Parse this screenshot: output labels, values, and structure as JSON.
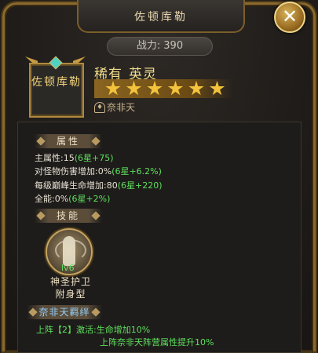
{
  "window": {
    "title": "佐顿库勒"
  },
  "power": {
    "label": "战力:",
    "value": "390"
  },
  "hero": {
    "portrait_name": "佐顿库勒",
    "rarity": "稀有",
    "type": "英灵",
    "stars": 6,
    "faction": "奈非天"
  },
  "attributes": {
    "header": "属性",
    "lines": [
      {
        "text": "主属性:15",
        "bonus": "(6星+75)"
      },
      {
        "text": "对怪物伤害增加:0%",
        "bonus": "(6星+6.2%)"
      },
      {
        "text": "每级巅峰生命增加:80",
        "bonus": "(6星+220)"
      },
      {
        "text": "全能:0%",
        "bonus": "(6星+2%)"
      }
    ]
  },
  "skill": {
    "header": "技能",
    "level": "lv6",
    "name": "神圣护卫",
    "type": "附身型"
  },
  "bond": {
    "header": "奈非天羁绊",
    "line1": "上阵【2】激活:生命增加10%",
    "line2": "上阵奈非天阵营属性提升10%"
  },
  "colors": {
    "gold": "#f0dc8c",
    "bonus_green": "#5de05d",
    "bond_blue": "#8fd0ff"
  }
}
